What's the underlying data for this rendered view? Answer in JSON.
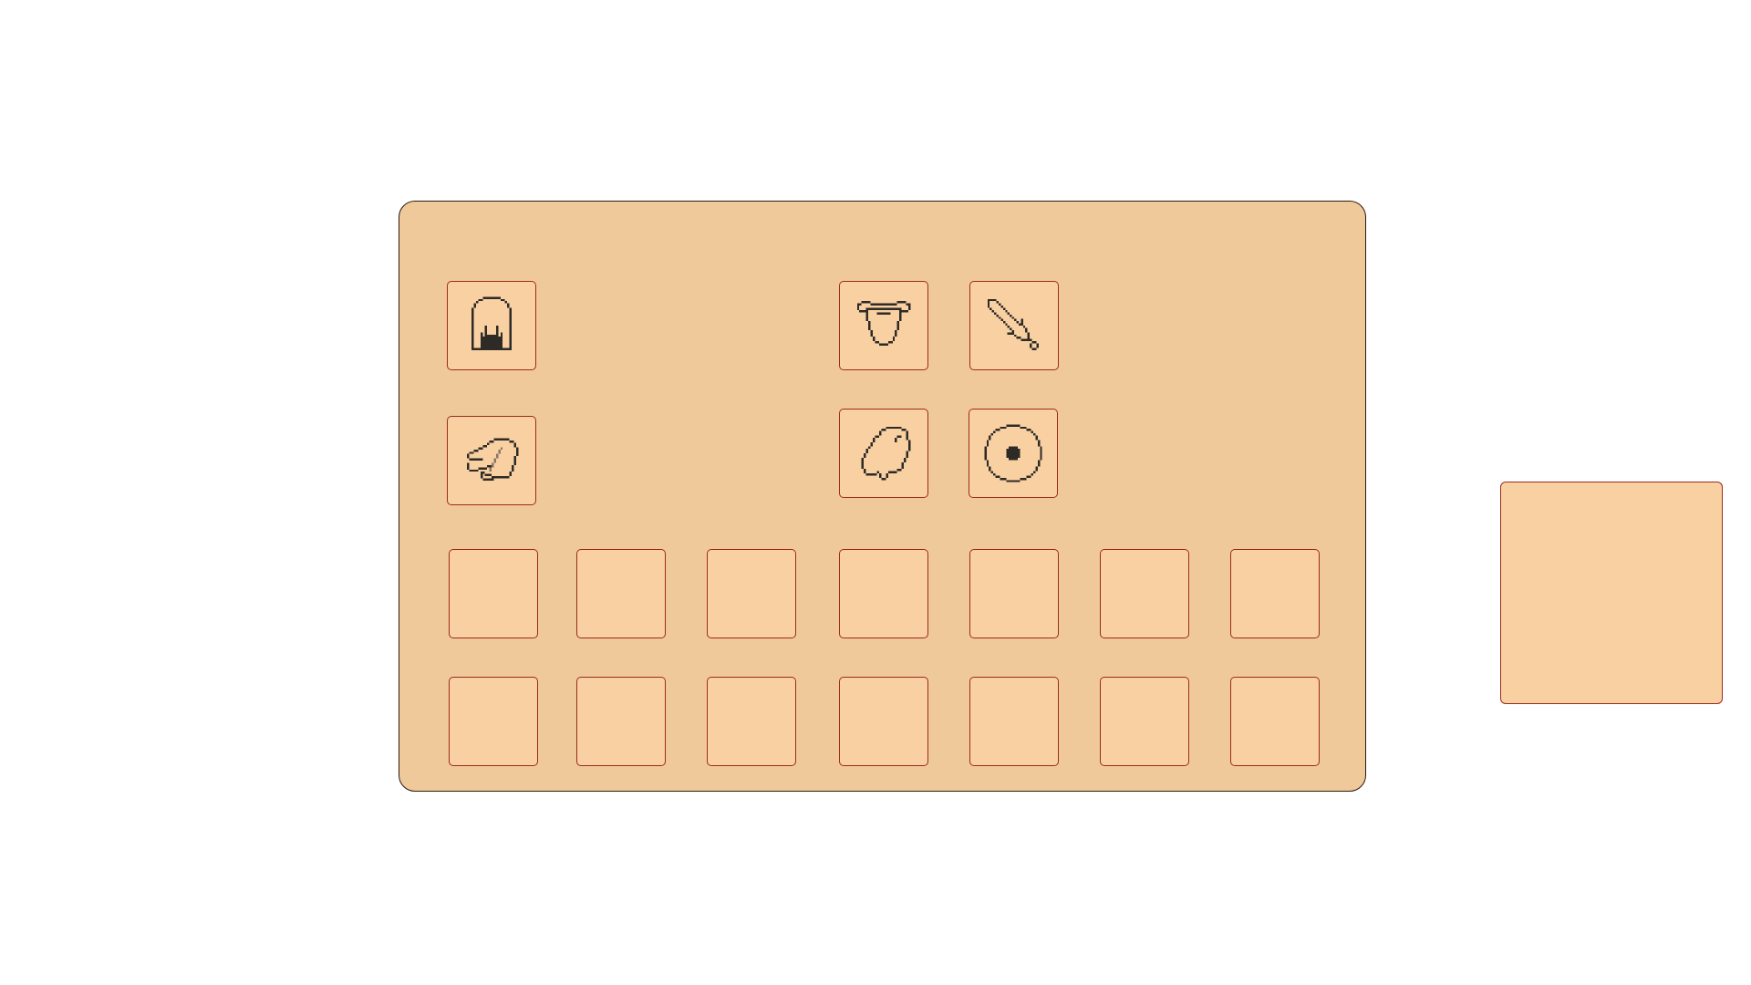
{
  "colors": {
    "panel_bg": "#F0C99A",
    "slot_bg": "#F8D0A2",
    "slot_border": "#9E2A1E",
    "icon_stroke": "#2E2A26",
    "icon_shade": "#8A7566"
  },
  "equipment": {
    "slots": [
      {
        "id": "helmet",
        "icon": "helmet-icon"
      },
      {
        "id": "boots",
        "icon": "boots-icon"
      },
      {
        "id": "armor",
        "icon": "chest-armor-icon"
      },
      {
        "id": "weapon",
        "icon": "sword-icon"
      },
      {
        "id": "gloves",
        "icon": "glove-icon"
      },
      {
        "id": "shield",
        "icon": "round-shield-icon"
      }
    ]
  },
  "character_preview": {
    "icon": "character-preview"
  },
  "inventory": {
    "rows": 2,
    "columns": 7,
    "items": []
  }
}
